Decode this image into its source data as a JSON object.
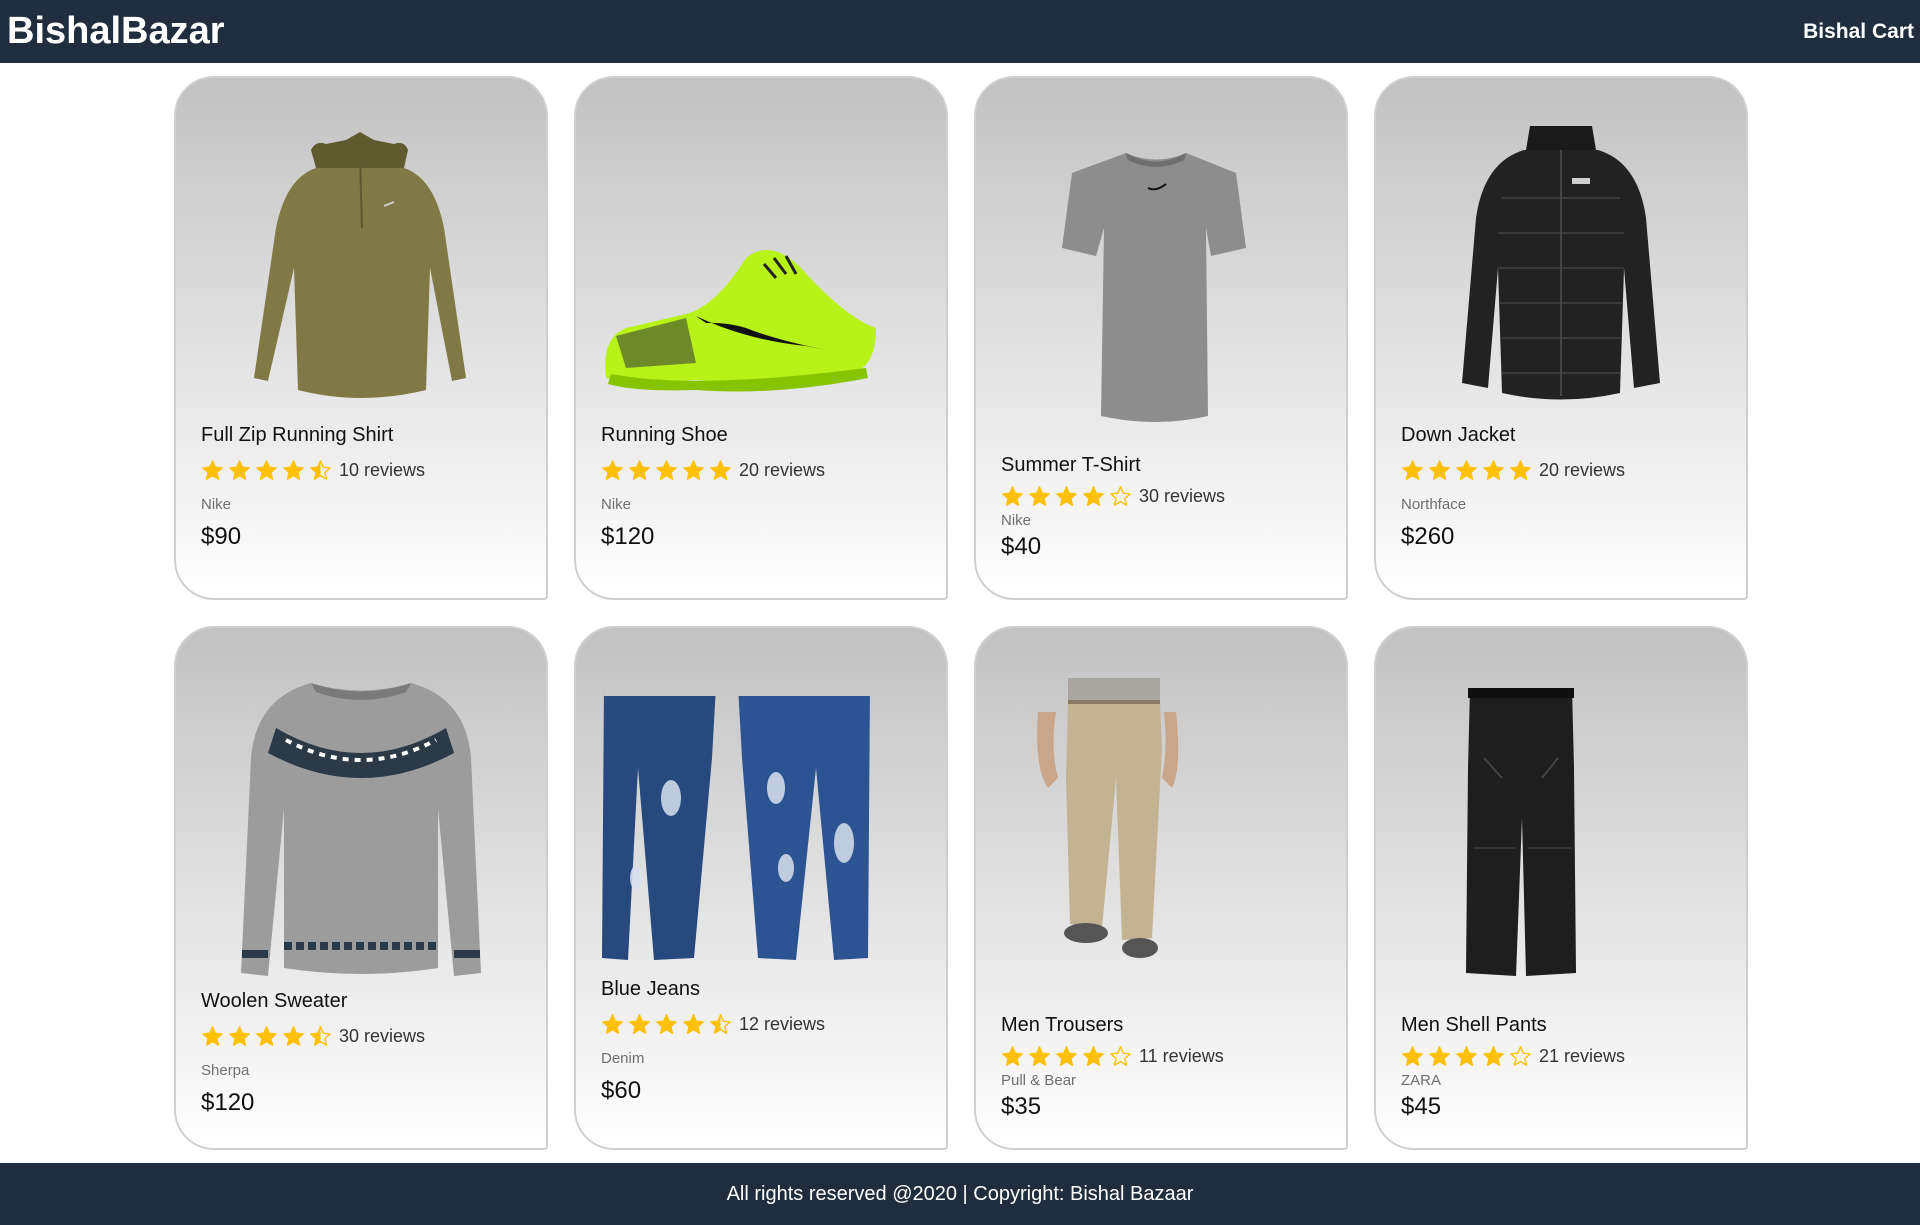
{
  "header": {
    "brand": "BishalBazar",
    "cart": "Bishal Cart"
  },
  "colors": {
    "nav_bg": "#202d3e",
    "star": "#ffc107",
    "card_border": "#cfcfcf"
  },
  "products": [
    {
      "name": "Full Zip Running Shirt",
      "rating": 4.5,
      "reviews": "10 reviews",
      "brand": "Nike",
      "price": "$90",
      "image_icon": "green-zip-shirt-image"
    },
    {
      "name": "Running Shoe",
      "rating": 5,
      "reviews": "20 reviews",
      "brand": "Nike",
      "price": "$120",
      "image_icon": "lime-running-shoe-image"
    },
    {
      "name": "Summer T-Shirt",
      "rating": 4,
      "reviews": "30 reviews",
      "brand": "Nike",
      "price": "$40",
      "image_icon": "grey-tshirt-image"
    },
    {
      "name": "Down Jacket",
      "rating": 5,
      "reviews": "20 reviews",
      "brand": "Northface",
      "price": "$260",
      "image_icon": "black-down-jacket-image"
    },
    {
      "name": "Woolen Sweater",
      "rating": 4.5,
      "reviews": "30 reviews",
      "brand": "Sherpa",
      "price": "$120",
      "image_icon": "grey-woolen-sweater-image"
    },
    {
      "name": "Blue Jeans",
      "rating": 4.5,
      "reviews": "12 reviews",
      "brand": "Denim",
      "price": "$60",
      "image_icon": "blue-jeans-image"
    },
    {
      "name": "Men Trousers",
      "rating": 4,
      "reviews": "11 reviews",
      "brand": "Pull & Bear",
      "price": "$35",
      "image_icon": "khaki-trousers-image"
    },
    {
      "name": "Men Shell Pants",
      "rating": 4,
      "reviews": "21 reviews",
      "brand": "ZARA",
      "price": "$45",
      "image_icon": "black-shell-pants-image"
    }
  ],
  "footer": {
    "text": "All rights reserved @2020 | Copyright: Bishal Bazaar"
  }
}
